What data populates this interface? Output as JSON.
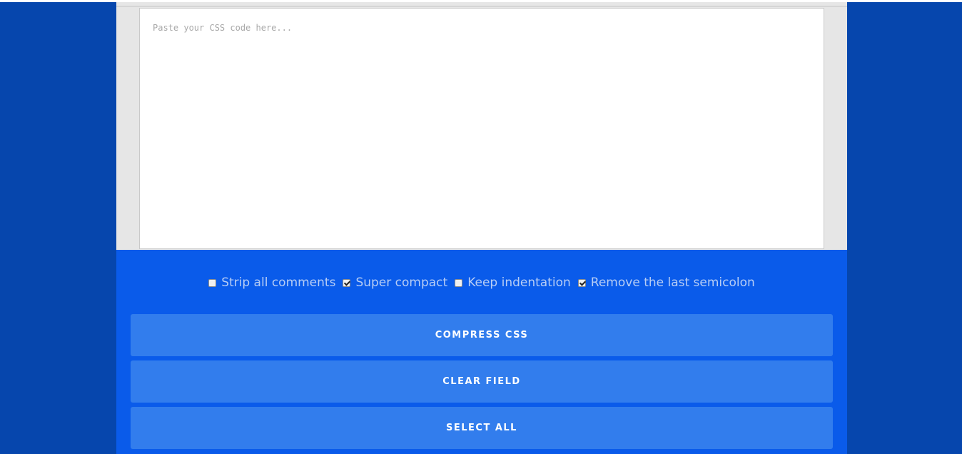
{
  "editor": {
    "placeholder": "Paste your CSS code here...",
    "value": ""
  },
  "options": [
    {
      "label": "Strip all comments",
      "checked": false
    },
    {
      "label": "Super compact",
      "checked": true
    },
    {
      "label": "Keep indentation",
      "checked": false
    },
    {
      "label": "Remove the last semicolon",
      "checked": true
    }
  ],
  "buttons": {
    "compress": "COMPRESS CSS",
    "clear": "CLEAR FIELD",
    "select_all": "SELECT ALL"
  },
  "colors": {
    "page_background": "#0646ad",
    "panel_background": "#0a5bea",
    "button_background": "#327ded",
    "option_text": "#b7cdf5"
  }
}
